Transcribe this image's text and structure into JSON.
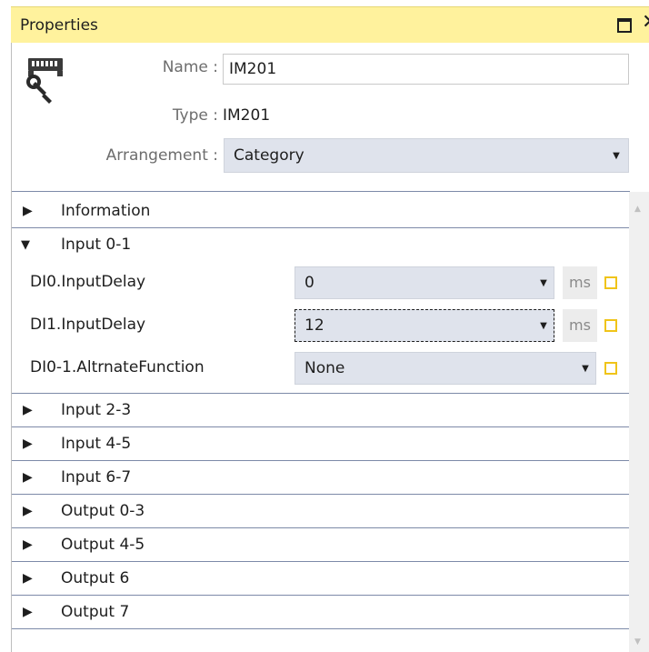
{
  "window": {
    "title": "Properties",
    "maximize_icon": "maximize-icon",
    "close_glyph": "✕"
  },
  "header": {
    "device_icon": "device-wrench-icon",
    "name_label": "Name :",
    "name_value": "IM201",
    "type_label": "Type :",
    "type_value": "IM201",
    "arrangement_label": "Arrangement :",
    "arrangement_value": "Category"
  },
  "grid": {
    "categories_top": [
      {
        "label": "Information",
        "expanded": false
      },
      {
        "label": "Input 0-1",
        "expanded": true
      }
    ],
    "properties": [
      {
        "name": "DI0.InputDelay",
        "value": "0",
        "unit": "ms",
        "focused": false
      },
      {
        "name": "DI1.InputDelay",
        "value": "12",
        "unit": "ms",
        "focused": true
      },
      {
        "name": "DI0-1.AltrnateFunction",
        "value": "None",
        "unit": "",
        "focused": false
      }
    ],
    "categories_bottom": [
      {
        "label": "Input 2-3",
        "expanded": false
      },
      {
        "label": "Input 4-5",
        "expanded": false
      },
      {
        "label": "Input 6-7",
        "expanded": false
      },
      {
        "label": "Output 0-3",
        "expanded": false
      },
      {
        "label": "Output 4-5",
        "expanded": false
      },
      {
        "label": "Output 6",
        "expanded": false
      },
      {
        "label": "Output 7",
        "expanded": false
      }
    ]
  },
  "colors": {
    "title_bar": "#fff29d",
    "combo_bg": "#dfe3ec",
    "separator": "#7d8aa8",
    "checkbox_border": "#f0c419"
  }
}
